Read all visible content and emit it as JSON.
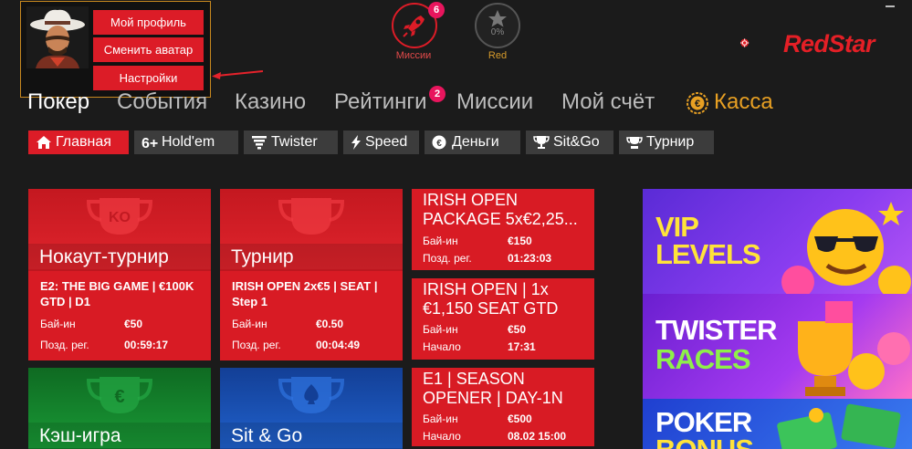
{
  "profile_menu": {
    "my_profile": "Мой профиль",
    "change_avatar": "Сменить аватар",
    "settings": "Настройки"
  },
  "missions_widget": {
    "label": "Миссии",
    "badge": "6"
  },
  "red_widget": {
    "label": "Red",
    "percent": "0%"
  },
  "logo": {
    "text": "RedStar"
  },
  "main_nav": {
    "poker": "Покер",
    "events": "События",
    "casino": "Казино",
    "ratings": "Рейтинги",
    "ratings_badge": "2",
    "missions": "Миссии",
    "account": "Мой счёт",
    "cashier": "Касса"
  },
  "sub_nav": {
    "home": "Главная",
    "holdem": "Hold'em",
    "twister": "Twister",
    "speed": "Speed",
    "money": "Деньги",
    "sitgo": "Sit&Go",
    "tournament": "Турнир"
  },
  "tiles": {
    "knockout": {
      "label": "Нокаут-турнир",
      "title": "E2: THE BIG GAME | €100K GTD | D1",
      "row1_label": "Бай-ин",
      "row1_value": "€50",
      "row2_label": "Позд. рег.",
      "row2_value": "00:59:17"
    },
    "tournament": {
      "label": "Турнир",
      "title": "IRISH OPEN 2x€5 | SEAT | Step 1",
      "row1_label": "Бай-ин",
      "row1_value": "€0.50",
      "row2_label": "Позд. рег.",
      "row2_value": "00:04:49"
    },
    "cash": {
      "label": "Кэш-игра"
    },
    "sitgo": {
      "label": "Sit & Go"
    }
  },
  "small_tiles": [
    {
      "title": "IRISH OPEN PACKAGE 5x€2,25...",
      "row1_label": "Бай-ин",
      "row1_value": "€150",
      "row2_label": "Позд. рег.",
      "row2_value": "01:23:03"
    },
    {
      "title": "IRISH OPEN | 1x €1,150 SEAT GTD",
      "row1_label": "Бай-ин",
      "row1_value": "€50",
      "row2_label": "Начало",
      "row2_value": "17:31"
    },
    {
      "title": "E1 | SEASON OPENER | DAY-1N",
      "row1_label": "Бай-ин",
      "row1_value": "€500",
      "row2_label": "Начало",
      "row2_value": "08.02 15:00"
    }
  ],
  "promos": {
    "vip": {
      "line1": "VIP",
      "line2": "LEVELS"
    },
    "twister": {
      "line1": "TWISTER",
      "line2": "RACES"
    },
    "poker": {
      "line1": "POKER",
      "line2": "BONUS"
    }
  },
  "colors": {
    "brand_red": "#dc1c27",
    "accent_gold": "#e8a023",
    "badge_pink": "#e8155d"
  }
}
